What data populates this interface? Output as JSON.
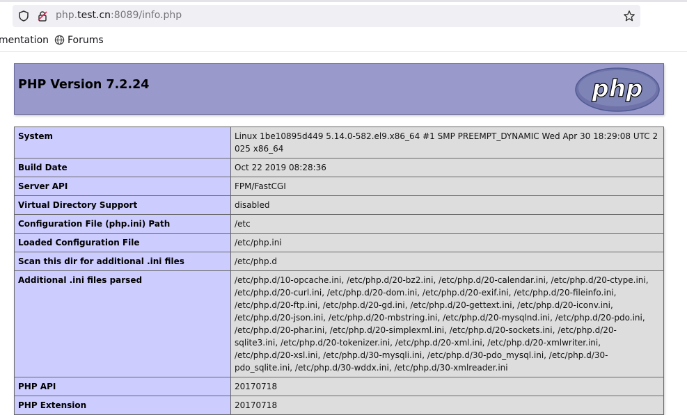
{
  "browser": {
    "url_prefix": "php.",
    "url_host": "test.cn",
    "url_suffix": ":8089/info.php"
  },
  "bookmarks": [
    {
      "label": "mentation"
    },
    {
      "label": "Forums"
    }
  ],
  "header": {
    "title": "PHP Version 7.2.24",
    "logo_text": "php"
  },
  "rows": [
    {
      "key": "System",
      "value": "Linux 1be10895d449 5.14.0-582.el9.x86_64 #1 SMP PREEMPT_DYNAMIC Wed Apr 30 18:29:08 UTC 2025 x86_64"
    },
    {
      "key": "Build Date",
      "value": "Oct 22 2019 08:28:36"
    },
    {
      "key": "Server API",
      "value": "FPM/FastCGI"
    },
    {
      "key": "Virtual Directory Support",
      "value": "disabled"
    },
    {
      "key": "Configuration File (php.ini) Path",
      "value": "/etc"
    },
    {
      "key": "Loaded Configuration File",
      "value": "/etc/php.ini"
    },
    {
      "key": "Scan this dir for additional .ini files",
      "value": "/etc/php.d"
    },
    {
      "key": "Additional .ini files parsed",
      "value": "/etc/php.d/10-opcache.ini, /etc/php.d/20-bz2.ini, /etc/php.d/20-calendar.ini, /etc/php.d/20-ctype.ini, /etc/php.d/20-curl.ini, /etc/php.d/20-dom.ini, /etc/php.d/20-exif.ini, /etc/php.d/20-fileinfo.ini, /etc/php.d/20-ftp.ini, /etc/php.d/20-gd.ini, /etc/php.d/20-gettext.ini, /etc/php.d/20-iconv.ini, /etc/php.d/20-json.ini, /etc/php.d/20-mbstring.ini, /etc/php.d/20-mysqlnd.ini, /etc/php.d/20-pdo.ini, /etc/php.d/20-phar.ini, /etc/php.d/20-simplexml.ini, /etc/php.d/20-sockets.ini, /etc/php.d/20-sqlite3.ini, /etc/php.d/20-tokenizer.ini, /etc/php.d/20-xml.ini, /etc/php.d/20-xmlwriter.ini, /etc/php.d/20-xsl.ini, /etc/php.d/30-mysqli.ini, /etc/php.d/30-pdo_mysql.ini, /etc/php.d/30-pdo_sqlite.ini, /etc/php.d/30-wddx.ini, /etc/php.d/30-xmlreader.ini"
    },
    {
      "key": "PHP API",
      "value": "20170718"
    },
    {
      "key": "PHP Extension",
      "value": "20170718"
    }
  ],
  "colors": {
    "header_bg": "#9999cc",
    "key_bg": "#ccccff",
    "value_bg": "#dddddd"
  }
}
